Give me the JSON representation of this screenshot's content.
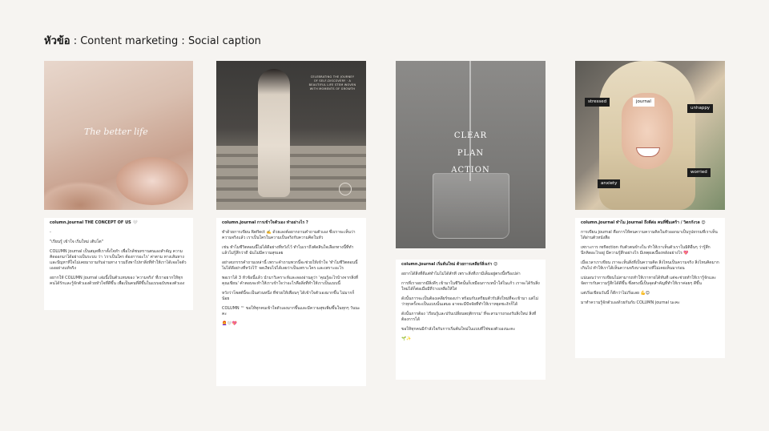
{
  "header": {
    "label": "หัวข้อ",
    "text": " : Content marketing : Social caption"
  },
  "cards": [
    {
      "image_text": "The better life",
      "caption": [
        "column.journal THE CONCEPT OF US 🤍",
        "-",
        "\"เรียนรู้ เข้าใจ เริ่มใหม่ เติบโต\"",
        "COLUMN journal เป็นสมุดที่เราตั้งใจทำ เพื่อใกล้ชนทรานตนเองสำคัญ ความคิดออกมาได้อย่างเป็นระบบ ว่า 'เราเป็นใคร ต้องการอะไร' ค่าตาม ทางเส้นทางและปัญหาที่ใจไม่เคยมาถามกับอ่านทาง รวมถึงพาไปหาสิ่งที่ทำให้เราได้เจอใจตัวเองอย่างแท้จริง",
        "อยากให้ COLUMN journal เล่มนี้เป็นตัวแทนของ 'ความจริง' ที่เราอยากให้ทุกคนได้รักและรู้จักตัวเองด้วยหัวใจที่ดีขึ้น เพื่อเป็นคนที่ดีขึ้นในแบบฉบับของตัวเอง"
      ]
    },
    {
      "image_text": "CELEBRATING THE JOURNEY OF SELF-DISCOVERY · A BEAUTIFUL LIFE STEM WOVEN WITH MOMENTS OF GROWTH",
      "caption": [
        "column.journal การเข้าใจตัวเอง ทำอย่างไร ?",
        "ทำด้วยการเขียน Reflect ✍️ ด้วยเลงค์อยากถามคำถามตัวเอง ซึ่งเราจะเห็นว่าความจริงแล้ว เราเป็นใครในความเป็นจริงกับความคิดในหัว",
        "เช่น ทำไมชีวิตตอนนี้ไม่ได้ดีอย่างที่หวังไว้ ทำไมเราถึงตัดสินใจเลือกทางนี้ที่ทำแล้วไม่รู้สึกว่าดี ฉันไม่มีความสุขเลย",
        "อย่าลบกรรรคำถามเหล่านี้ เพราะคำถามพวกนี้จะช่วยให้เข้าใจ 'ทำไมชีวิตตอนนี้ไม่ได้ดีอย่างที่หวังไว้' จดเงียบไปได้เลยว่าเป็นเพราะใคร และเพราะอะไร",
        "พอเราได้ 3 หัวข้อนี้แล้ว นำมาวิเคราะห์และลองอ่านดูว่า 'คุณรู้อะไรบ้างจากสิ่งที่คุณเขียน' คำตอบจะทำให้เราเข้าใจว่าอะไรคือสิ่งที่ทำให้เราเป็นแบบนี้",
        "หวังว่าโพสต์นี้จะเป็นส่วนหนึ่ง ที่ช่วยให้เพื่อนๆ ได้เข้าใจตัวเองมากขึ้น ไม่มากก็น้อย",
        "COLUMN ™ ขอให้ทุกคนเข้าใจตัวเองมากขึ้นและมีความสุขเพิ่มขึ้นในทุกๆ วันนะคะ",
        "👩‍🦰🤍💖"
      ]
    },
    {
      "image_words": [
        "CLEAR",
        "PLAN",
        "ACTION"
      ],
      "caption": [
        "column.journal เริ่มต้นใหม่ ด้วยการเคลียร์สิ่งเก่า 😌",
        "อยากได้สิ่งที่ดีแต่ทำไมไม่ได้สักที เพราะสิ่งที่เรามีเต็มอยู่ตรงนี้หรือเปล่า",
        "การที่เราอยากมีสิ่งดีๆ เข้ามาในชีวิตนั้นก็เหมือนการเทน้ำใส่ในแก้ว เราจะได้รับสิ่งใหม่ได้ก็ต่อเมื่อมีที่ว่างเหลือให้ใส่",
        "ดังนั้นการจะเป็นต้องเคลียร์ของเก่า พร้อมกับเตรียมตัวรับสิ่งใหม่ที่จะเข้ามา แต่ไม่ว่าทุกครั้งจะเป็นแบบนั้นเสมอ อาจจะมีปัจจัยที่ทำให้เราหยุดชะงักก็ได้",
        "ดังนั้นการต้อง 'เรียนรู้และปรับเปลี่ยนพฤติกรรม' ที่จะสามารถรองรับสิ่งใหม่ สิ่งที่ต้องการได้",
        "ขอให้ทุกคนมีกำลังใจกับการเริ่มต้นใหม่ในแบบที่ใช่ของตัวเองนะคะ",
        "🌱✨"
      ]
    },
    {
      "tags": [
        "stressed",
        "journal",
        "unhappy",
        "anxiety",
        "worried"
      ],
      "caption": [
        "column.journal ทำไม journal ถึงดีต่อ คนที่ซึมเศร้า / วิตกกังวล 😊",
        "การเขียน journal คือการให้คนความความคิดในหัวออกมาเป็นรูปธรรมที่เราเห็นได้ผ่านตัวหนังสือ",
        "เพราะการ reflection กับตัวตนข้างใน ทำให้เราเห็นตัวเราในมิติอื่นๆ ว่ารู้สึกนึกคิดอะไรอยู่ มีความรู้สึกอย่างไร มีเหตุผลเบื้องหลังอย่างไร 💖",
        "เมื่อเวลาเราเขียน เราจะเห็นสิ่งที่เป็นความคิด สิ่งไหนเป็นความจริง สิ่งไหนคิดมากเกินไป ทำให้เราได้เห็นความจริงบางอย่างที่ไม่เคยเห็นมาก่อน",
        "แน่นอนว่าการเขียนไม่สามารถทำให้เราหายได้ทันที แต่จะช่วยทำให้เรารู้จักและจัดการกับความรู้สึกได้ดีขึ้น ซึ่งตรงนี้เป็นจุดสำคัญที่ทำให้เราค่อยๆ ดีขึ้น",
        "แต่เริ่มเขียนวันนี้ ก็ดีกว่าไม่เริ่มเลย 💪😊",
        "มาทำความรู้จักตัวเองด้วยกันกับ COLUMN journal นะคะ"
      ]
    }
  ]
}
